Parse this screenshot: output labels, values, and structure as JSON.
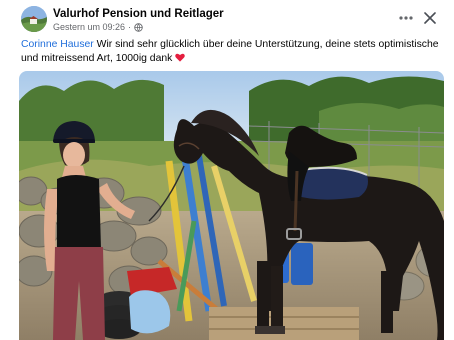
{
  "post": {
    "page_name": "Valurhof Pension und Reitlager",
    "timestamp": "Gestern um 09:26",
    "separator": "·",
    "caption": {
      "mention": "Corinne Hauser",
      "text": " Wir sind sehr glücklich über deine Unterstützung, deine stets optimistische und mitreissend Art, 1000ig dank "
    }
  },
  "icons": {
    "privacy": "globe-icon",
    "more": "more-options-icon",
    "close": "close-icon",
    "emoji": "red-heart-icon"
  },
  "colors": {
    "mention_link": "#216fdb",
    "secondary_text": "#65676b",
    "heart": "#e41e3f"
  }
}
